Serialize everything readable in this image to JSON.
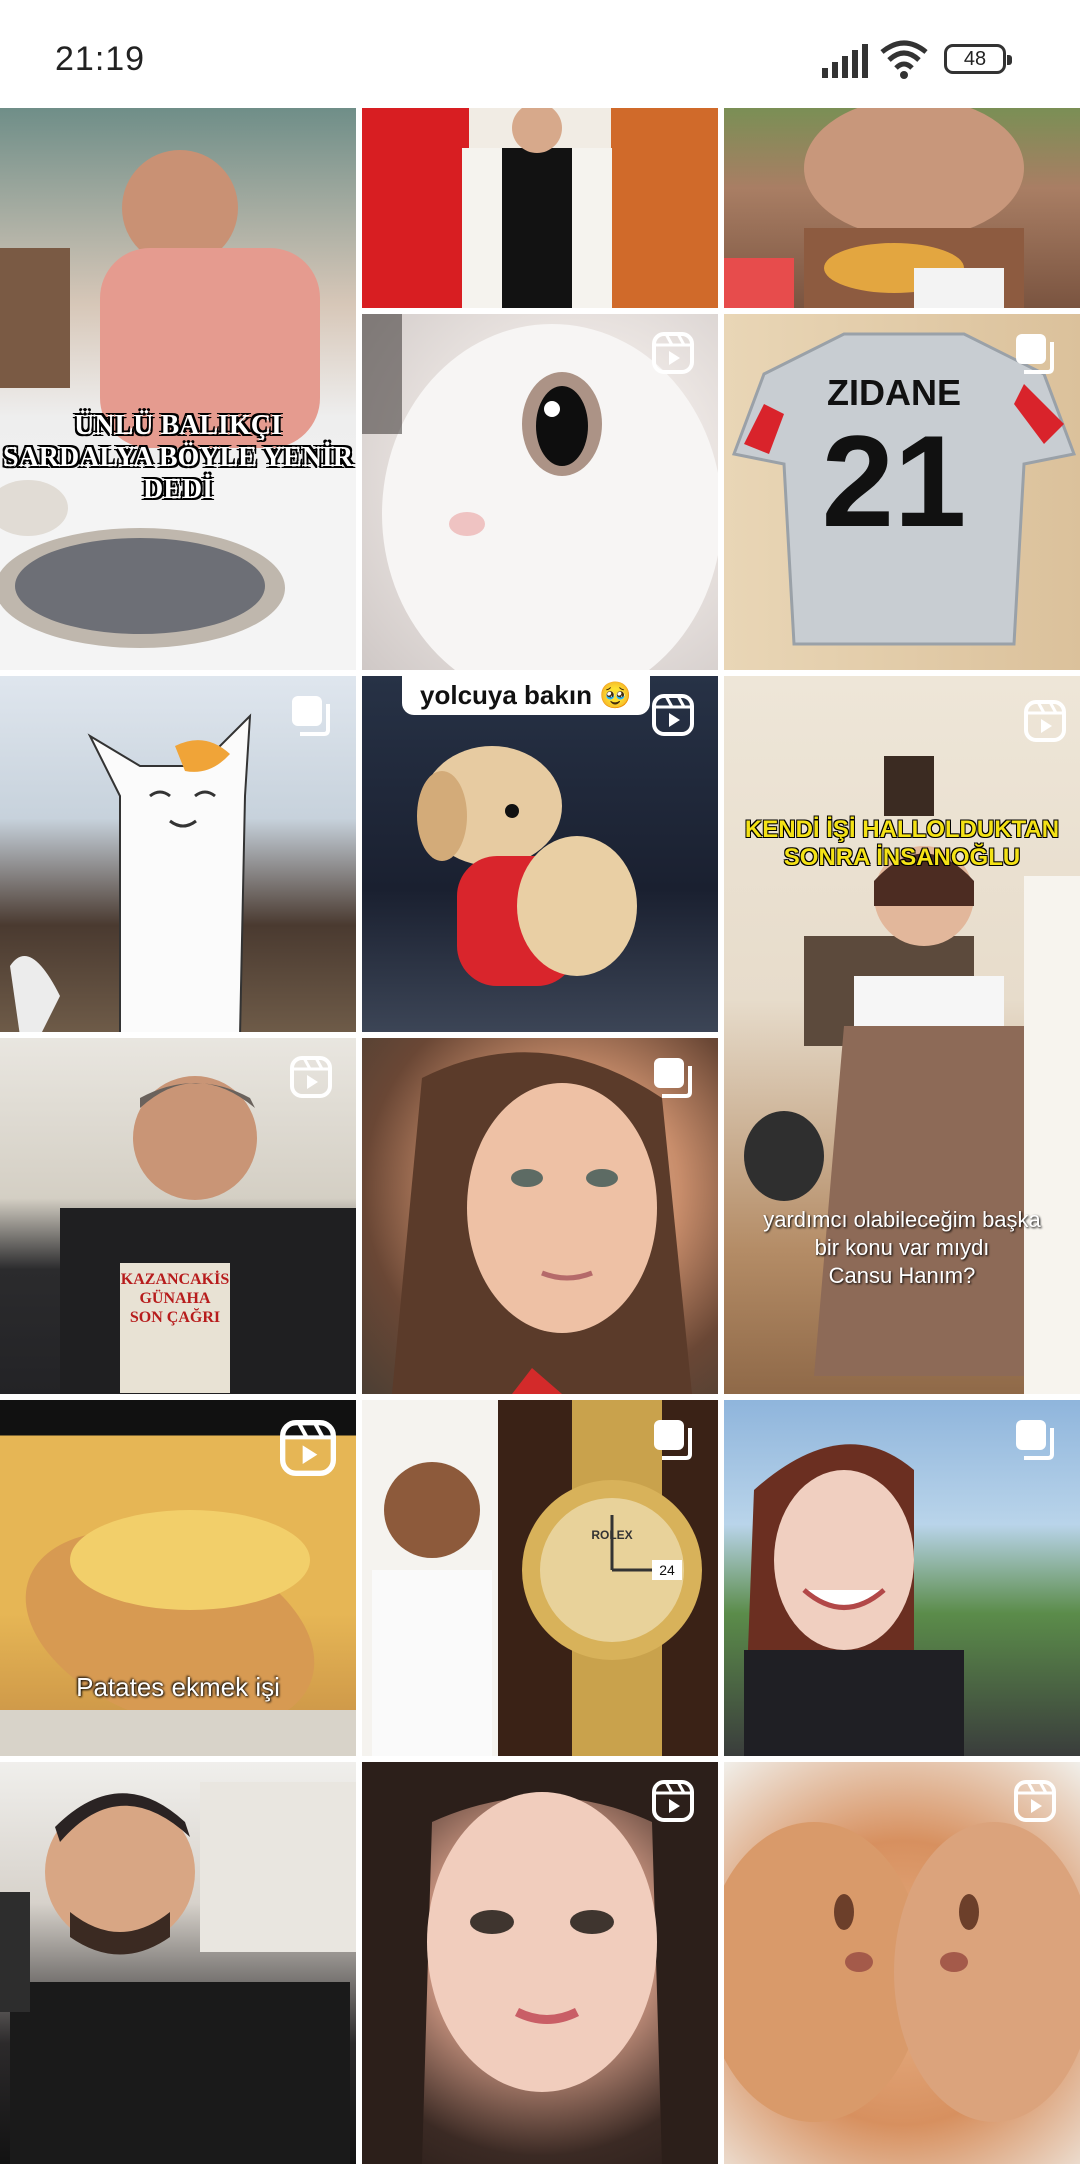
{
  "status_bar": {
    "time": "21:19",
    "battery": "48",
    "icons": [
      "signal-icon",
      "wifi-icon",
      "battery-icon"
    ]
  },
  "grid": {
    "tiles": [
      {
        "id": 1,
        "overlay_lines": [
          "ÜNLÜ BALIKÇI",
          "SARDALYA BÖYLE YENİR",
          "DEDİ"
        ],
        "badge": null
      },
      {
        "id": 2,
        "badge": null
      },
      {
        "id": 3,
        "badge": null
      },
      {
        "id": 4,
        "badge": "reels-icon"
      },
      {
        "id": 5,
        "badge": "carousel-icon",
        "jersey_name": "ZIDANE",
        "jersey_number": "21"
      },
      {
        "id": 6,
        "badge": "carousel-icon"
      },
      {
        "id": 7,
        "badge": "reels-icon",
        "caption": "yolcuya bakın 🥹"
      },
      {
        "id": 8,
        "badge": "reels-icon",
        "headline_lines": [
          "KENDİ İŞİ HALLOLDUKTAN",
          "SONRA İNSANOĞLU"
        ],
        "subtitle_lines": [
          "yardımcı olabileceğim başka",
          "bir konu var mıydı",
          "Cansu Hanım?"
        ]
      },
      {
        "id": 9,
        "badge": "reels-icon",
        "book_title_lines": [
          "KAZANCAKİS",
          "GÜNAHA",
          "SON ÇAĞRI"
        ]
      },
      {
        "id": 10,
        "badge": "carousel-icon"
      },
      {
        "id": 11,
        "badge": "reels-icon",
        "caption": "Patates ekmek işi"
      },
      {
        "id": 12,
        "badge": "carousel-icon",
        "watch_brand": "ROLEX",
        "watch_date": "24"
      },
      {
        "id": 13,
        "badge": "carousel-icon"
      },
      {
        "id": 14,
        "badge": null
      },
      {
        "id": 15,
        "badge": "reels-icon"
      },
      {
        "id": 16,
        "badge": "reels-icon"
      }
    ]
  }
}
